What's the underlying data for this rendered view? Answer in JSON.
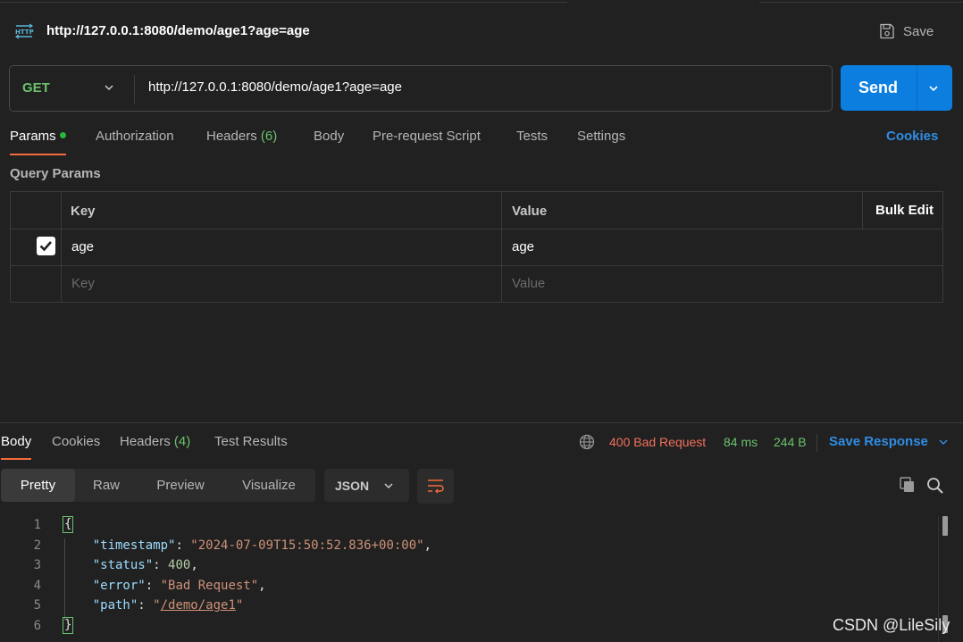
{
  "header": {
    "protocol_icon": "http-icon",
    "title": "http://127.0.0.1:8080/demo/age1?age=age",
    "save_label": "Save"
  },
  "request": {
    "method": "GET",
    "url": "http://127.0.0.1:8080/demo/age1?age=age",
    "send_label": "Send"
  },
  "tabs": {
    "params": "Params",
    "authorization": "Authorization",
    "headers": "Headers",
    "headers_count": "(6)",
    "body": "Body",
    "prerequest": "Pre-request Script",
    "tests": "Tests",
    "settings": "Settings",
    "cookies": "Cookies"
  },
  "query_params": {
    "title": "Query Params",
    "col_key": "Key",
    "col_value": "Value",
    "bulk_edit": "Bulk Edit",
    "rows": [
      {
        "checked": true,
        "key": "age",
        "value": "age"
      }
    ],
    "key_placeholder": "Key",
    "value_placeholder": "Value"
  },
  "response": {
    "tabs": {
      "body": "Body",
      "cookies": "Cookies",
      "headers": "Headers",
      "headers_count": "(4)",
      "test_results": "Test Results"
    },
    "status": "400 Bad Request",
    "time": "84 ms",
    "size": "244 B",
    "save_response": "Save Response",
    "modes": [
      "Pretty",
      "Raw",
      "Preview",
      "Visualize"
    ],
    "format": "JSON",
    "line_numbers": [
      "1",
      "2",
      "3",
      "4",
      "5",
      "6"
    ],
    "body": {
      "open": "{",
      "close": "}",
      "timestamp_key": "\"timestamp\"",
      "timestamp_val": "\"2024-07-09T15:50:52.836+00:00\"",
      "status_key": "\"status\"",
      "status_val": "400",
      "error_key": "\"error\"",
      "error_val": "\"Bad Request\"",
      "path_key": "\"path\"",
      "path_val": "/demo/age1"
    }
  },
  "watermark": "CSDN @LileSily",
  "colors": {
    "accent_blue": "#0b7ee0",
    "method_green": "#6bc26b",
    "error_red": "#f2705b",
    "tab_indicator": "#f26b3a"
  }
}
